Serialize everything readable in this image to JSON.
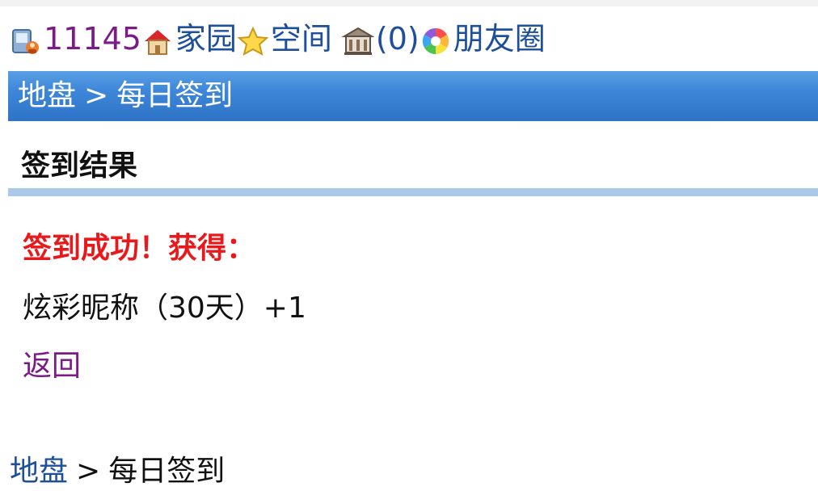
{
  "topbar": {
    "user_id": "11145",
    "home_label": "家园",
    "space_label": "空间",
    "notice_count": "(0)",
    "friends_label": "朋友圈"
  },
  "titlebar": {
    "crumb_root": "地盘",
    "separator": ">",
    "crumb_current": "每日签到"
  },
  "section": {
    "title": "签到结果"
  },
  "result": {
    "success_text": "签到成功！获得：",
    "reward_text": "炫彩昵称（30天）+1",
    "back_label": "返回"
  },
  "footer": {
    "crumb_root": "地盘",
    "separator": ">",
    "crumb_current": "每日签到"
  },
  "colors": {
    "link_blue": "#1d4f9b",
    "link_purple": "#7a1b86",
    "title_bar": "#3d86d8",
    "success_red": "#e8191b",
    "divider": "#a9c8ec"
  }
}
